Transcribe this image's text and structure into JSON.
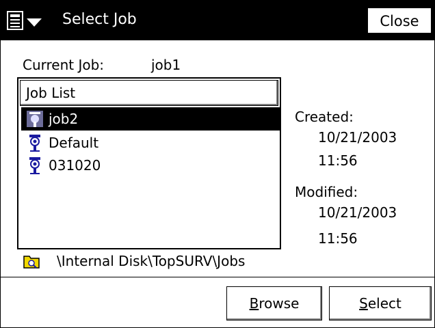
{
  "titlebar": {
    "title": "Select Job",
    "close_label": "Close",
    "menu_icon": "start-menu-icon",
    "dropdown_icon": "dropdown-arrow-icon"
  },
  "current_job": {
    "label": "Current Job:",
    "value": "job1"
  },
  "job_list": {
    "header": "Job List",
    "selected_index": 0,
    "items": [
      {
        "label": "job2",
        "icon": "job-icon"
      },
      {
        "label": "Default",
        "icon": "job-icon"
      },
      {
        "label": "031020",
        "icon": "job-icon"
      }
    ]
  },
  "details": {
    "created_label": "Created:",
    "created_date": "10/21/2003",
    "created_time": "11:56",
    "modified_label": "Modified:",
    "modified_date": "10/21/2003",
    "modified_time": "11:56"
  },
  "path": {
    "icon": "folder-icon",
    "text": "\\Internal Disk\\TopSURV\\Jobs"
  },
  "buttons": {
    "browse_mnemonic": "B",
    "browse_rest": "rowse",
    "select_mnemonic": "S",
    "select_rest": "elect"
  },
  "colors": {
    "titlebar_bg": "#000000",
    "selection_bg": "#000000",
    "job_icon_blue": "#1a1aa0",
    "folder_yellow": "#f0d800"
  }
}
